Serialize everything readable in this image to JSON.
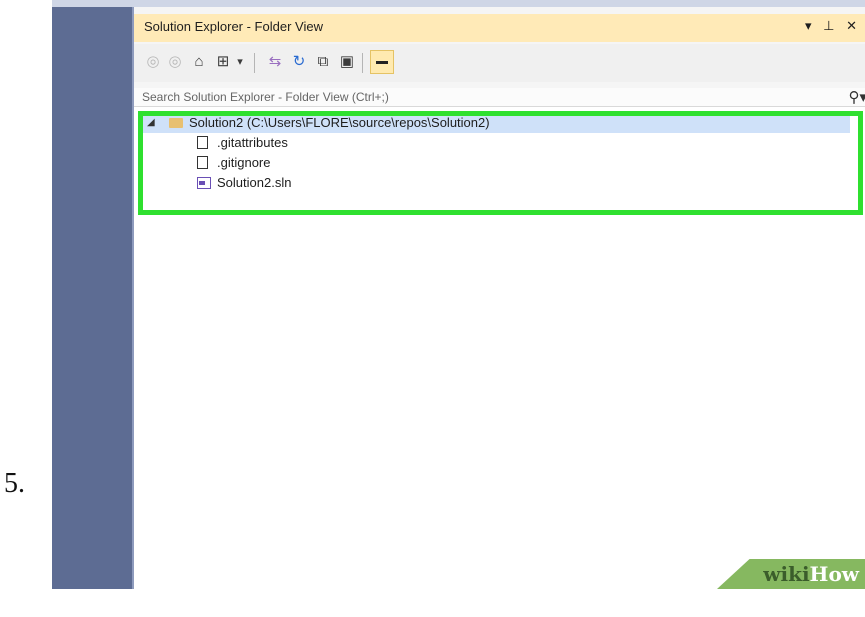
{
  "step": {
    "number": "5."
  },
  "panel": {
    "title": "Solution Explorer - Folder View",
    "controls": [
      "▾",
      "⊥",
      "✕"
    ]
  },
  "toolbar": {
    "buttons": [
      {
        "name": "back-icon",
        "glyph": "◎"
      },
      {
        "name": "forward-icon",
        "glyph": "◎"
      },
      {
        "name": "home-icon",
        "glyph": "⌂"
      },
      {
        "name": "switch-views-icon",
        "glyph": "⊞"
      },
      {
        "name": "dropdown-icon",
        "glyph": "▾"
      },
      {
        "name": "sync-icon",
        "glyph": "⇆"
      },
      {
        "name": "refresh-icon",
        "glyph": "↻"
      },
      {
        "name": "collapse-all-icon",
        "glyph": "⧉"
      },
      {
        "name": "show-all-files-icon",
        "glyph": "▣"
      }
    ]
  },
  "search": {
    "placeholder": "Search Solution Explorer - Folder View (Ctrl+;)"
  },
  "tree": {
    "root": {
      "label": "Solution2 (C:\\Users\\FLORE\\source\\repos\\Solution2)"
    },
    "files": [
      {
        "label": ".gitattributes",
        "type": "file"
      },
      {
        "label": ".gitignore",
        "type": "file"
      },
      {
        "label": "Solution2.sln",
        "type": "sln"
      }
    ]
  },
  "watermark": {
    "part1": "wiki",
    "part2": "How"
  },
  "colors": {
    "highlight": "#2fe02f",
    "title_bar": "#ffeab7",
    "selection": "#cfe1f9"
  }
}
